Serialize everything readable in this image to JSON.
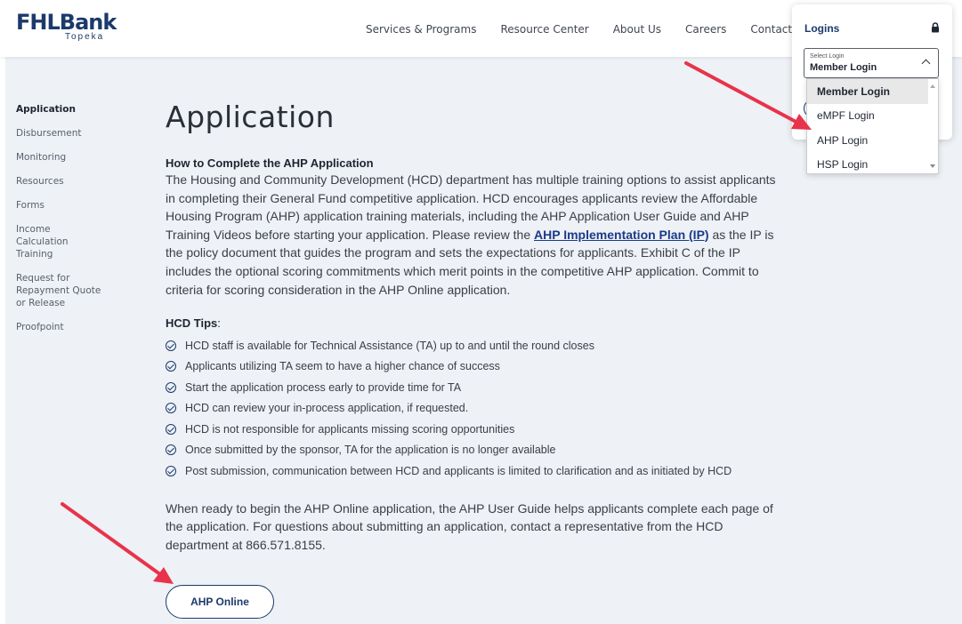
{
  "brand": {
    "logo_text": "FHLBank",
    "logo_sub": "Topeka"
  },
  "nav": {
    "items": [
      "Services & Programs",
      "Resource Center",
      "About Us",
      "Careers",
      "Contact"
    ]
  },
  "logins": {
    "title": "Logins",
    "select_small_label": "Select Login",
    "selected": "Member Login",
    "options": [
      "Member Login",
      "eMPF Login",
      "AHP Login",
      "HSP Login"
    ]
  },
  "sidebar": {
    "items": [
      "Application",
      "Disbursement",
      "Monitoring",
      "Resources",
      "Forms",
      "Income Calculation Training",
      "Request for Repayment Quote or Release",
      "Proofpoint"
    ]
  },
  "main": {
    "title": "Application",
    "subhead": "How to Complete the AHP Application",
    "para_before_link": "The Housing and Community Development (HCD) department has multiple training options to assist applicants in completing their General Fund competitive application. HCD encourages applicants review the Affordable Housing Program (AHP) application training materials, including the AHP Application User Guide and AHP Training Videos before starting your application. Please review the ",
    "link_text": "AHP Implementation Plan (IP)",
    "para_after_link": " as the IP is the policy document that guides the program and sets the expectations for applicants. Exhibit C of the IP includes the optional scoring commitments which merit points in the competitive AHP application. Commit to criteria for scoring consideration in the AHP Online application.",
    "tips_head": "HCD Tips",
    "tips_colon": ":",
    "tips": [
      "HCD staff is available for Technical Assistance (TA) up to and until the round closes",
      "Applicants utilizing TA seem to have a higher chance of success",
      "Start the application process early to provide time for TA",
      "HCD can review your in-process application, if requested.",
      "HCD is not responsible for applicants missing scoring opportunities",
      "Once submitted by the sponsor, TA for the application is no longer available",
      "Post submission, communication between HCD and applicants is limited to clarification and as initiated by HCD"
    ],
    "closing_para": "When ready to begin the AHP Online application, the AHP User Guide helps applicants complete each page of the application. For questions about submitting an application, contact a representative from the HCD department at 866.571.8155.",
    "cta_label": "AHP Online"
  },
  "colors": {
    "brand_navy": "#1b3a6b",
    "page_bg": "#eef1f5",
    "arrow_red": "#e8334a"
  },
  "icons": [
    "lock-icon",
    "chevron-up-icon",
    "check-circle-icon",
    "red-arrow-icon"
  ]
}
